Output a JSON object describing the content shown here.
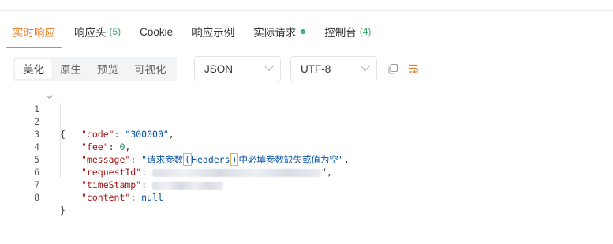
{
  "tabs": [
    {
      "label": "实时响应",
      "count": "",
      "dot": false,
      "active": true
    },
    {
      "label": "响应头",
      "count": "(5)",
      "dot": false,
      "active": false
    },
    {
      "label": "Cookie",
      "count": "",
      "dot": false,
      "active": false
    },
    {
      "label": "响应示例",
      "count": "",
      "dot": false,
      "active": false
    },
    {
      "label": "实际请求",
      "count": "",
      "dot": true,
      "active": false
    },
    {
      "label": "控制台",
      "count": "(4)",
      "dot": false,
      "active": false
    }
  ],
  "view_modes": [
    "美化",
    "原生",
    "预览",
    "可视化"
  ],
  "format_select": "JSON",
  "charset_select": "UTF-8",
  "icons": {
    "copy": "copy-icon",
    "format": "format-icon",
    "fold": "chevron-down-icon"
  },
  "colors": {
    "accent": "#f07f22",
    "count": "#3aa46a",
    "dot": "#3cb371"
  },
  "code": {
    "line_numbers": [
      "1",
      "2",
      "3",
      "4",
      "5",
      "6",
      "7",
      "8"
    ],
    "open_brace": "{",
    "close_brace": "}",
    "code_key": "\"code\"",
    "code_value": "\"300000\"",
    "fee_key": "\"fee\"",
    "fee_value": "0",
    "message_key": "\"message\"",
    "message_value_pre": "\"请求参数",
    "message_value_hl1": "(",
    "message_value_mid": "Headers",
    "message_value_hl2": ")",
    "message_value_post": "中必填参数缺失或值为空\"",
    "requestId_key": "\"requestId\"",
    "timeStamp_key": "\"timeStamp\"",
    "content_key": "\"content\"",
    "content_value": "null"
  }
}
